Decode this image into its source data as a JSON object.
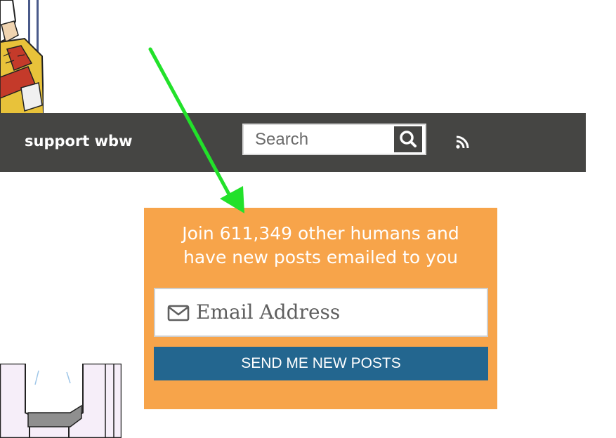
{
  "nav": {
    "support_label": "support wbw",
    "search_placeholder": "Search",
    "search_icon": "search-icon",
    "rss_icon": "rss-icon",
    "background": "#454543"
  },
  "subscribe": {
    "line1": "Join 611,349 other humans and",
    "line2": "have new posts emailed to you",
    "email_placeholder": "Email Address",
    "email_icon": "envelope-icon",
    "button_label": "SEND ME NEW POSTS",
    "background": "#f7a44a",
    "button_color": "#23668f"
  },
  "annotation": {
    "arrow_color": "#22e12a"
  }
}
